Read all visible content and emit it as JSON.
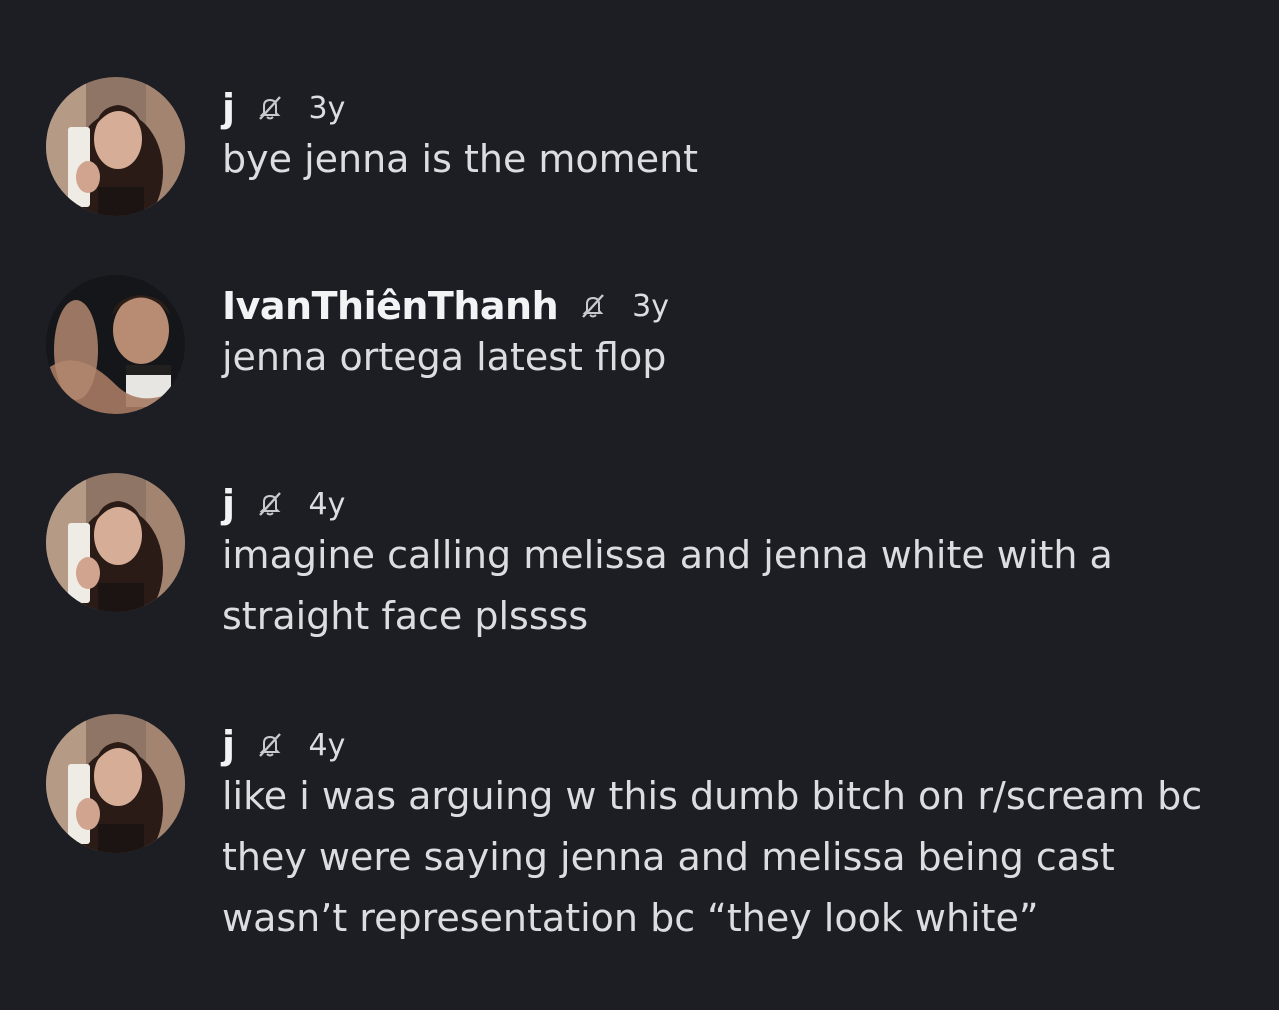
{
  "messages": [
    {
      "username": "j",
      "timestamp": "3y",
      "text": "bye jenna is the moment",
      "avatar": "woman-with-phone-avatar",
      "mute_icon": "muted-bell-icon"
    },
    {
      "username": "IvanThiênThanh",
      "timestamp": "3y",
      "text": "jenna ortega latest flop",
      "avatar": "man-reaching-hand-avatar",
      "mute_icon": "muted-bell-icon"
    },
    {
      "username": "j",
      "timestamp": "4y",
      "text": "imagine calling melissa and jenna white with a straight face plssss",
      "avatar": "woman-with-phone-avatar",
      "mute_icon": "muted-bell-icon"
    },
    {
      "username": "j",
      "timestamp": "4y",
      "text": "like i was arguing w this dumb bitch on r/scream bc they were saying jenna and melissa being cast wasn’t representation bc “they look white”",
      "avatar": "woman-with-phone-avatar",
      "mute_icon": "muted-bell-icon"
    }
  ],
  "colors": {
    "background": "#1d1e23",
    "username": "#f2f3f5",
    "text": "#dcdde1",
    "icon": "#c8c9cd"
  }
}
